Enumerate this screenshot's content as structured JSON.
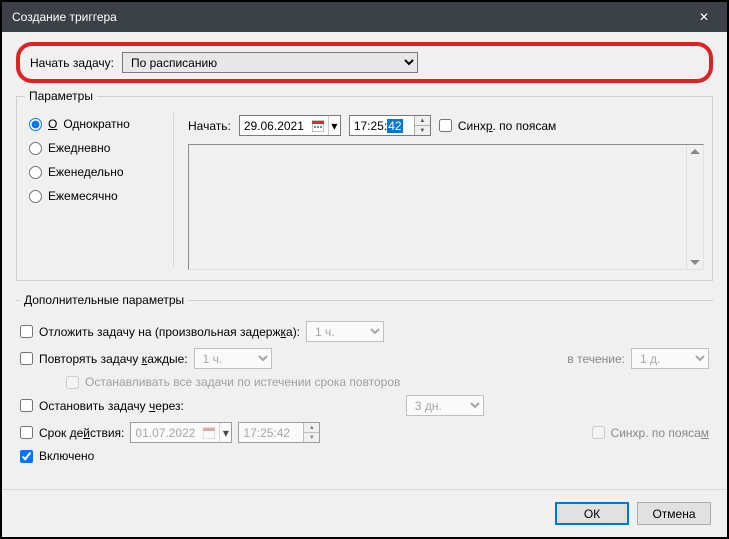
{
  "window": {
    "title": "Создание триггера"
  },
  "begin": {
    "label": "Начать задачу:",
    "value": "По расписанию"
  },
  "params": {
    "legend": "Параметры",
    "radios": {
      "once": "Однократно",
      "daily": "Ежедневно",
      "weekly": "Еженедельно",
      "monthly": "Ежемесячно"
    },
    "start_label": "Начать:",
    "date": "29.06.2021",
    "time_prefix": "17:25:",
    "time_sel": "42",
    "sync_tz": "Синхр. по поясам"
  },
  "adv": {
    "legend": "Дополнительные параметры",
    "delay_label": "Отложить задачу на (произвольная задержка):",
    "delay_val": "1 ч.",
    "repeat_label": "Повторять задачу каждые:",
    "repeat_val": "1 ч.",
    "duration_label": "в течение:",
    "duration_val": "1 д.",
    "stop_all": "Останавливать все задачи по истечении срока повторов",
    "stop_after_label": "Остановить задачу через:",
    "stop_after_val": "3 дн.",
    "expire_label": "Срок действия:",
    "expire_date": "01.07.2022",
    "expire_time": "17:25:42",
    "expire_sync": "Синхр. по поясам",
    "enabled": "Включено"
  },
  "buttons": {
    "ok": "ОК",
    "cancel": "Отмена"
  }
}
